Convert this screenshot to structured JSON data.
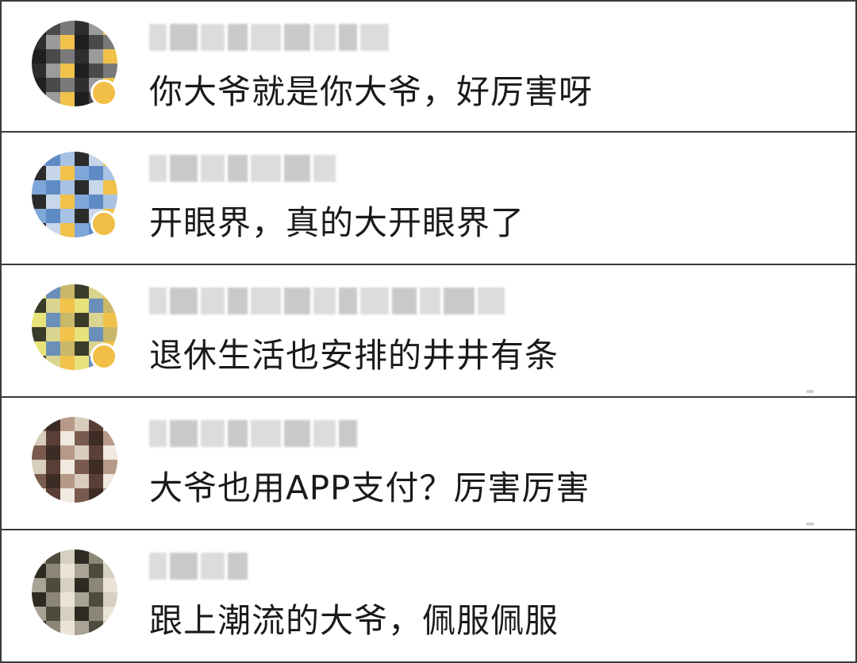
{
  "comments": [
    {
      "text": "你大爷就是你大爷，好厉害呀",
      "username_blocks": 9,
      "verified": true,
      "avatar_palette": [
        "#1f1f1f",
        "#4a4a4a",
        "#7a7a7a",
        "#2e2e2e",
        "#9b9b9b",
        "#f0c24a"
      ]
    },
    {
      "text": "开眼界，真的大开眼界了",
      "username_blocks": 7,
      "verified": true,
      "avatar_palette": [
        "#7fa6d8",
        "#5f8bc4",
        "#a9c2e4",
        "#2b2b2b",
        "#c8d6ea",
        "#f0c24a"
      ]
    },
    {
      "text": "退休生活也安排的井井有条",
      "username_blocks": 13,
      "verified": true,
      "avatar_palette": [
        "#e8e27a",
        "#6b8fb8",
        "#c9b86a",
        "#3b3b2a",
        "#d9d48f",
        "#f0c24a"
      ]
    },
    {
      "text": "大爷也用APP支付？厉害厉害",
      "username_blocks": 8,
      "verified": false,
      "avatar_palette": [
        "#7a5a4e",
        "#3d2b26",
        "#b69a87",
        "#d8cdbd",
        "#5a3f36",
        "#efe9df"
      ]
    },
    {
      "text": "跟上潮流的大爷，佩服佩服",
      "username_blocks": 4,
      "verified": false,
      "avatar_palette": [
        "#a8a394",
        "#4f4a3e",
        "#d6d0c1",
        "#2e2a22",
        "#8c8677",
        "#e9e4d6"
      ]
    }
  ]
}
